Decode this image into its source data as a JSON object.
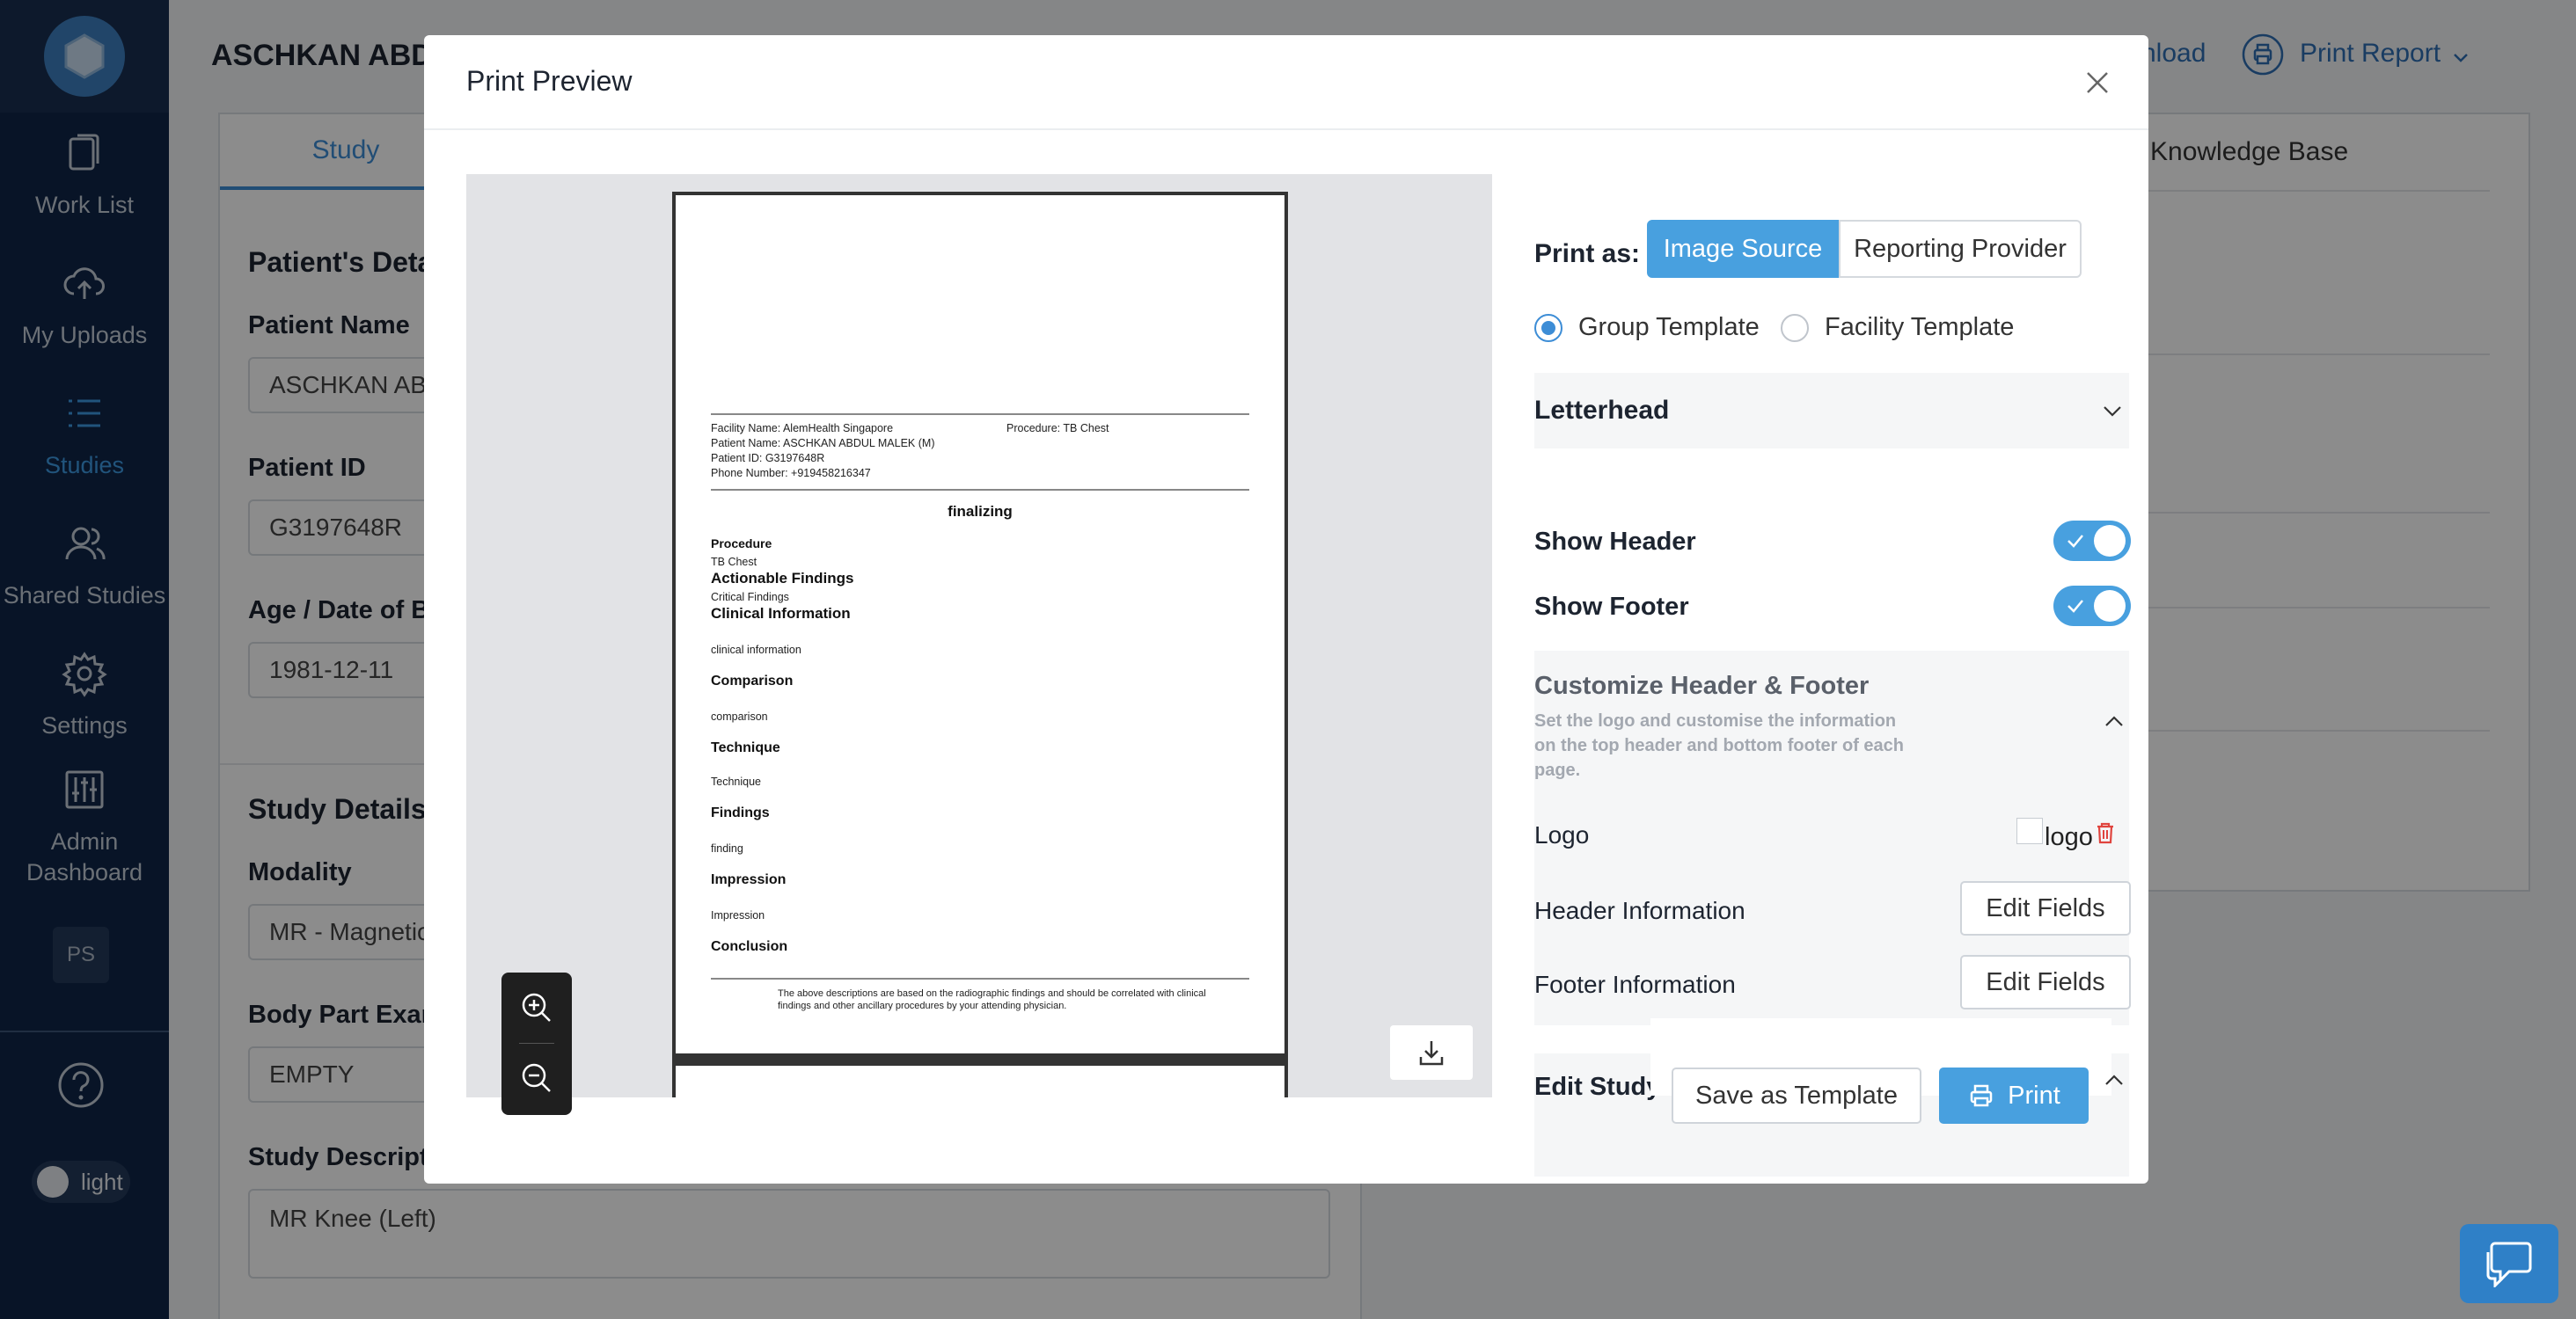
{
  "sidebar": {
    "items": [
      {
        "label": "Work List",
        "icon": "clipboard-icon"
      },
      {
        "label": "My Uploads",
        "icon": "cloud-upload-icon"
      },
      {
        "label": "Studies",
        "icon": "list-icon"
      },
      {
        "label": "Shared Studies",
        "icon": "users-icon"
      },
      {
        "label": "Settings",
        "icon": "gear-icon"
      },
      {
        "label": "Admin Dashboard",
        "icon": "sliders-icon"
      }
    ],
    "user_initials": "PS",
    "theme_label": "light"
  },
  "background": {
    "patient_name_header": "ASCHKAN ABDU",
    "download_label": "nload",
    "print_report_label": "Print Report",
    "tab_study": "Study",
    "tab_knowledge_base": "Knowledge Base",
    "patients_details": "Patient's Deta",
    "patient_name_label": "Patient Name",
    "patient_name_value": "ASCHKAN AB",
    "patient_id_label": "Patient ID",
    "patient_id_value": "G3197648R",
    "age_label": "Age / Date of B",
    "age_value": "1981-12-11",
    "study_details": "Study Details",
    "modality_label": "Modality",
    "modality_value": "MR - Magnetic",
    "body_part_label": "Body Part Exam",
    "body_part_value": "EMPTY",
    "study_desc_label": "Study Descript",
    "study_desc_value": "MR Knee (Left)"
  },
  "modal": {
    "title": "Print Preview",
    "report": {
      "facility": "Facility Name: AlemHealth Singapore",
      "procedure_header": "Procedure: TB Chest",
      "patient_name": "Patient Name: ASCHKAN ABDUL MALEK (M)",
      "patient_id": "Patient ID: G3197648R",
      "phone": "Phone Number: +919458216347",
      "status": "finalizing",
      "sections": [
        {
          "heading": "Procedure",
          "text": "TB Chest"
        },
        {
          "heading": "Actionable Findings",
          "text": "Critical Findings"
        },
        {
          "heading": "Clinical Information",
          "text": "clinical information"
        },
        {
          "heading": "Comparison",
          "text": "comparison"
        },
        {
          "heading": "Technique",
          "text": "Technique"
        },
        {
          "heading": "Findings",
          "text": "finding"
        },
        {
          "heading": "Impression",
          "text": "Impression"
        },
        {
          "heading": "Conclusion",
          "text": ""
        }
      ],
      "disclaimer_1": "The above descriptions are based on the radiographic findings and should be correlated with clinical",
      "disclaimer_2": "findings and other ancillary procedures by your attending physician."
    },
    "settings": {
      "print_as_label": "Print as:",
      "print_as_options": [
        "Image Source",
        "Reporting Provider"
      ],
      "template_options": [
        "Group Template",
        "Facility Template"
      ],
      "letterhead_label": "Letterhead",
      "show_header_label": "Show Header",
      "show_footer_label": "Show Footer",
      "customize_title": "Customize Header & Footer",
      "customize_desc": "Set the logo and customise the information on the top header and bottom footer of each page.",
      "logo_label": "Logo",
      "logo_alt": "logo",
      "header_info_label": "Header Information",
      "footer_info_label": "Footer Information",
      "edit_fields_label": "Edit Fields",
      "next_section_title": "Edit Study Information"
    },
    "save_template_label": "Save as Template",
    "print_label": "Print"
  }
}
